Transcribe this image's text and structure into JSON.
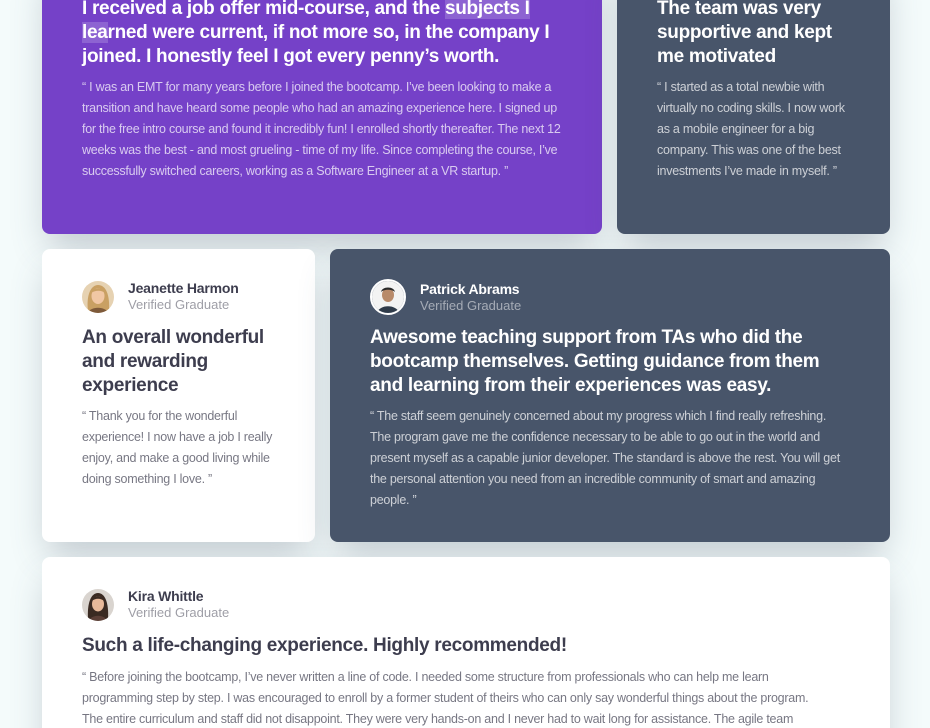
{
  "colors": {
    "page_background": "#f4fbfb",
    "purple_card": "#7541c8",
    "slate_card": "#48556a",
    "white_card": "#ffffff",
    "dark_text": "#3d3d4e"
  },
  "testimonials": {
    "daniel": {
      "headline_pre": "I received a job offer mid-course, and the ",
      "headline_mark": "subjects I lea",
      "headline_post": "rned were current, if not more so, in the company I joined. I honestly feel I got every penny’s worth.",
      "quote": "“ I was an EMT for many years before I joined the bootcamp. I’ve been looking to make a transition and have heard some people who had an amazing experience here. I signed up for the free intro course and found it incredibly fun! I enrolled shortly thereafter. The next 12 weeks was the best - and most grueling - time of my life. Since completing the course, I’ve successfully switched careers, working as a Software Engineer at a VR startup. ”"
    },
    "jonathan": {
      "headline": "The team was very supportive and kept me motivated",
      "quote": "“ I started as a total newbie with virtually no coding skills. I now work as a mobile engineer for a big company. This was one of the best investments I’ve made in myself. ”"
    },
    "jeanette": {
      "name": "Jeanette Harmon",
      "role": "Verified Graduate",
      "headline": "An overall wonderful and rewarding experience",
      "quote": "“ Thank you for the wonderful experience! I now have a job I really enjoy, and make a good living while doing something I love. ”"
    },
    "patrick": {
      "name": "Patrick Abrams",
      "role": "Verified Graduate",
      "headline": "Awesome teaching support from TAs who did the bootcamp themselves. Getting guidance from them and learning from their experiences was easy.",
      "quote": "“ The staff seem genuinely concerned about my progress which I find really refreshing. The program gave me the confidence necessary to be able to go out in the world and present myself as a capable junior developer. The standard is above the rest. You will get the personal attention you need from an incredible community of smart and amazing people. ”"
    },
    "kira": {
      "name": "Kira Whittle",
      "role": "Verified Graduate",
      "headline": "Such a life-changing experience. Highly recommended!",
      "quote": "“ Before joining the bootcamp, I’ve never written a line of code. I needed some structure from professionals who can help me learn programming step by step. I was encouraged to enroll by a former student of theirs who can only say wonderful things about the program. The entire curriculum and staff did not disappoint. They were very hands-on and I never had to wait long for assistance. The agile team"
    }
  }
}
